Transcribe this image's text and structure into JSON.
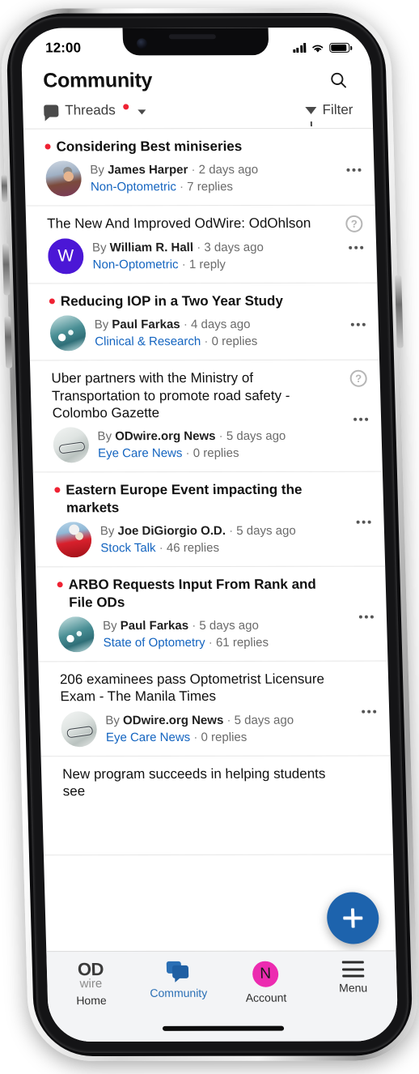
{
  "status_bar": {
    "time": "12:00",
    "signal_icon": "cellular-bars-icon",
    "wifi_icon": "wifi-icon",
    "battery_icon": "battery-icon"
  },
  "header": {
    "title": "Community",
    "search_icon": "search-icon"
  },
  "subbar": {
    "threads_label": "Threads",
    "threads_icon": "speech-bubble-icon",
    "has_unread_dot": true,
    "dropdown_icon": "chevron-down-icon",
    "filter_label": "Filter",
    "filter_icon": "funnel-icon"
  },
  "colors": {
    "unread_dot": "#ef2233",
    "link": "#1565c0",
    "fab": "#1d63ad",
    "accent_active_tab": "#2a6fb5",
    "account_avatar": "#ec2bb0",
    "avatar_letter_bg": "#4b17d6"
  },
  "threads": [
    {
      "title": "Considering Best miniseries",
      "unread": true,
      "author": "James Harper",
      "age": "2 days ago",
      "category": "Non-Optometric",
      "replies": "7 replies",
      "avatar_type": "photo",
      "avatar_style": "av-photo-harper",
      "avatar_letter": "",
      "badge": ""
    },
    {
      "title": "The New And Improved OdWire: OdOhlson",
      "unread": false,
      "author": "William R. Hall",
      "age": "3 days ago",
      "category": "Non-Optometric",
      "replies": "1 reply",
      "avatar_type": "letter",
      "avatar_style": "",
      "avatar_letter": "W",
      "badge": "?"
    },
    {
      "title": "Reducing IOP in a Two Year Study",
      "unread": true,
      "author": "Paul Farkas",
      "age": "4 days ago",
      "category": "Clinical & Research",
      "replies": "0 replies",
      "avatar_type": "photo",
      "avatar_style": "av-sail",
      "avatar_letter": "",
      "badge": ""
    },
    {
      "title": "Uber partners with the Ministry of Transportation to promote road safety - Colombo Gazette",
      "unread": false,
      "author": "ODwire.org News",
      "age": "5 days ago",
      "category": "Eye Care News",
      "replies": "0 replies",
      "avatar_type": "photo",
      "avatar_style": "av-glasses",
      "avatar_letter": "",
      "badge": "?"
    },
    {
      "title": "Eastern Europe Event impacting the markets",
      "unread": true,
      "author": "Joe DiGiorgio O.D.",
      "age": "5 days ago",
      "category": "Stock Talk",
      "replies": "46 replies",
      "avatar_type": "photo",
      "avatar_style": "av-ski",
      "avatar_letter": "",
      "badge": ""
    },
    {
      "title": "ARBO Requests Input From Rank and File ODs",
      "unread": true,
      "author": "Paul Farkas",
      "age": "5 days ago",
      "category": "State of Optometry",
      "replies": "61 replies",
      "avatar_type": "photo",
      "avatar_style": "av-sail",
      "avatar_letter": "",
      "badge": ""
    },
    {
      "title": "206 examinees pass Optometrist Licensure Exam - The Manila Times",
      "unread": false,
      "author": "ODwire.org News",
      "age": "5 days ago",
      "category": "Eye Care News",
      "replies": "0 replies",
      "avatar_type": "photo",
      "avatar_style": "av-glasses",
      "avatar_letter": "",
      "badge": ""
    }
  ],
  "partial_thread": {
    "title": "New program succeeds in helping students see"
  },
  "fab": {
    "icon": "plus-icon",
    "label": "New thread"
  },
  "tabbar": {
    "items": [
      {
        "label": "Home",
        "icon": "odwire-logo-icon",
        "active": false,
        "logo_top": "OD",
        "logo_bottom": "wire"
      },
      {
        "label": "Community",
        "icon": "community-bubbles-icon",
        "active": true,
        "logo_top": "",
        "logo_bottom": ""
      },
      {
        "label": "Account",
        "icon": "account-avatar-icon",
        "active": false,
        "logo_top": "N",
        "logo_bottom": ""
      },
      {
        "label": "Menu",
        "icon": "hamburger-menu-icon",
        "active": false,
        "logo_top": "",
        "logo_bottom": ""
      }
    ]
  }
}
